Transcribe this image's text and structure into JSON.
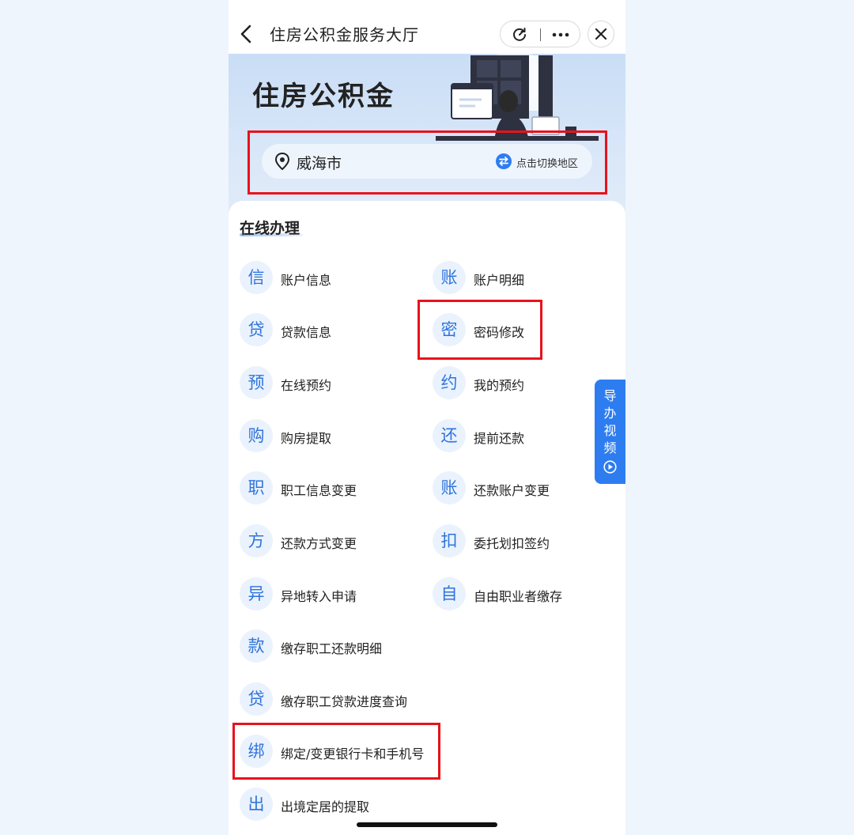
{
  "navbar": {
    "title": "住房公积金服务大厅",
    "back_icon": "chevron-left-icon",
    "refresh_icon": "refresh-icon",
    "more_icon": "more-dots-icon",
    "close_icon": "close-icon"
  },
  "banner": {
    "title": "住房公积金",
    "city": "威海市",
    "switch_label": "点击切换地区",
    "location_icon": "map-pin-icon",
    "switch_icon": "swap-arrows-icon"
  },
  "section": {
    "title": "在线办理"
  },
  "services": [
    {
      "badge": "信",
      "label": "账户信息"
    },
    {
      "badge": "账",
      "label": "账户明细"
    },
    {
      "badge": "贷",
      "label": "贷款信息"
    },
    {
      "badge": "密",
      "label": "密码修改"
    },
    {
      "badge": "预",
      "label": "在线预约"
    },
    {
      "badge": "约",
      "label": "我的预约"
    },
    {
      "badge": "购",
      "label": "购房提取"
    },
    {
      "badge": "还",
      "label": "提前还款"
    },
    {
      "badge": "职",
      "label": "职工信息变更"
    },
    {
      "badge": "账",
      "label": "还款账户变更"
    },
    {
      "badge": "方",
      "label": "还款方式变更"
    },
    {
      "badge": "扣",
      "label": "委托划扣签约"
    },
    {
      "badge": "异",
      "label": "异地转入申请"
    },
    {
      "badge": "自",
      "label": "自由职业者缴存"
    },
    {
      "badge": "款",
      "label": "缴存职工还款明细"
    },
    {
      "badge": "贷",
      "label": "缴存职工贷款进度查询"
    },
    {
      "badge": "绑",
      "label": "绑定/变更银行卡和手机号"
    },
    {
      "badge": "出",
      "label": "出境定居的提取"
    }
  ],
  "guide_tab": {
    "chars": [
      "导",
      "办",
      "视",
      "频"
    ],
    "icon": "play-circle-icon"
  },
  "colors": {
    "accent": "#2f74dc",
    "badge_bg": "#eaf2fd",
    "highlight_frame": "#e8121c",
    "guide_tab": "#2d7df0"
  }
}
